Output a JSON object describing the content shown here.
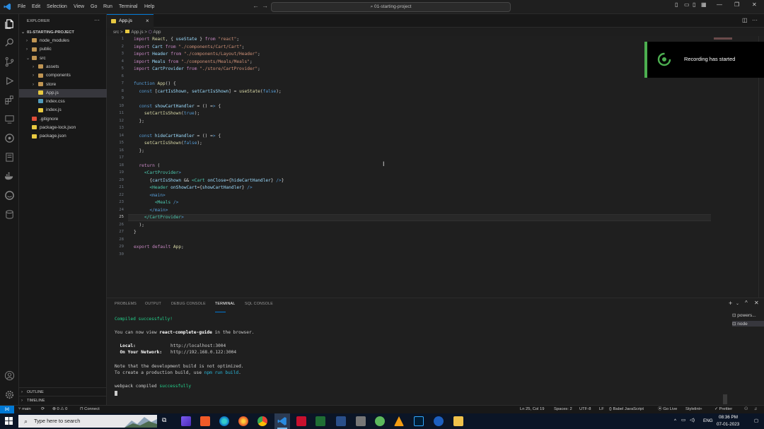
{
  "menu": [
    "File",
    "Edit",
    "Selection",
    "View",
    "Go",
    "Run",
    "Terminal",
    "Help"
  ],
  "search": {
    "text": "01-starting-project"
  },
  "explorer": {
    "title": "EXPLORER",
    "project": "01-STARTING-PROJECT",
    "items": [
      {
        "label": "node_modules",
        "indent": 1,
        "type": "folder",
        "chevron": "›"
      },
      {
        "label": "public",
        "indent": 1,
        "type": "folder",
        "chevron": "›"
      },
      {
        "label": "src",
        "indent": 1,
        "type": "folder",
        "chevron": "⌄"
      },
      {
        "label": "assets",
        "indent": 2,
        "type": "folder",
        "chevron": "›"
      },
      {
        "label": "components",
        "indent": 2,
        "type": "folder",
        "chevron": "›"
      },
      {
        "label": "store",
        "indent": 2,
        "type": "folder",
        "chevron": "›"
      },
      {
        "label": "App.js",
        "indent": 2,
        "type": "js",
        "selected": true
      },
      {
        "label": "index.css",
        "indent": 2,
        "type": "css"
      },
      {
        "label": "index.js",
        "indent": 2,
        "type": "js"
      },
      {
        "label": ".gitignore",
        "indent": 1,
        "type": "git"
      },
      {
        "label": "package-lock.json",
        "indent": 1,
        "type": "json"
      },
      {
        "label": "package.json",
        "indent": 1,
        "type": "json"
      }
    ],
    "outline": "OUTLINE",
    "timeline": "TIMELINE"
  },
  "tab": {
    "label": "App.js",
    "close": "×"
  },
  "breadcrumb": {
    "src": "src",
    "sep": ">",
    "file": "App.js",
    "symbol": "App"
  },
  "code": [
    "import React, { useState } from \"react\";",
    "import Cart from \"./components/Cart/Cart\";",
    "import Header from \"./components/Layout/Header\";",
    "import Meals from \"./components/Meals/Meals\";",
    "import CartProvider from \"./store/CartProvider\";",
    "",
    "function App() {",
    "  const [cartIsShown, setCartIsShown] = useState(false);",
    "",
    "  const showCartHandler = () => {",
    "    setCartIsShown(true);",
    "  };",
    "",
    "  const hideCartHandler = () => {",
    "    setCartIsShown(false);",
    "  };",
    "",
    "  return (",
    "    <CartProvider>",
    "      {cartIsShown && <Cart onClose={hideCartHandler} />}",
    "      <Header onShowCart={showCartHandler} />",
    "      <main>",
    "        <Meals />",
    "      </main>",
    "    </CartProvider>",
    "  );",
    "}",
    "",
    "export default App;",
    ""
  ],
  "current_line": 25,
  "notification": {
    "text": "Recording has started"
  },
  "panel": {
    "tabs": [
      "PROBLEMS",
      "OUTPUT",
      "DEBUG CONSOLE",
      "TERMINAL",
      "SQL CONSOLE"
    ],
    "active_tab": "TERMINAL",
    "terminal": {
      "compiled": "Compiled successfully!",
      "view_pre": "You can now view ",
      "app_name": "react-complete-guide",
      "view_post": " in the browser.",
      "local_label": "  Local:",
      "local_url": "http://localhost:3004",
      "network_label": "  On Your Network:",
      "network_url": "http://192.168.0.122:3004",
      "note1": "Note that the development build is not optimized.",
      "note2_pre": "To create a production build, use ",
      "note2_cmd": "npm run build",
      "note2_post": ".",
      "webpack_pre": "webpack compiled ",
      "webpack_status": "successfully"
    },
    "terminals": [
      "powers...",
      "node"
    ]
  },
  "status": {
    "branch": "main",
    "problems": "⊗ 0 ⚠ 0",
    "connect": "Connect",
    "position": "Ln 25, Col 19",
    "spaces": "Spaces: 2",
    "encoding": "UTF-8",
    "eol": "LF",
    "language": "{} Babel JavaScript",
    "golive": "Go Live",
    "stylelint": "Stylelint+",
    "prettier": "✓ Prettier"
  },
  "taskbar": {
    "search_placeholder": "Type here to search",
    "lang": "ENG",
    "time": "08:36 PM",
    "date": "07-01-2023"
  },
  "colors": {
    "accent": "#0078d4",
    "notification_bar": "#4caf50"
  }
}
